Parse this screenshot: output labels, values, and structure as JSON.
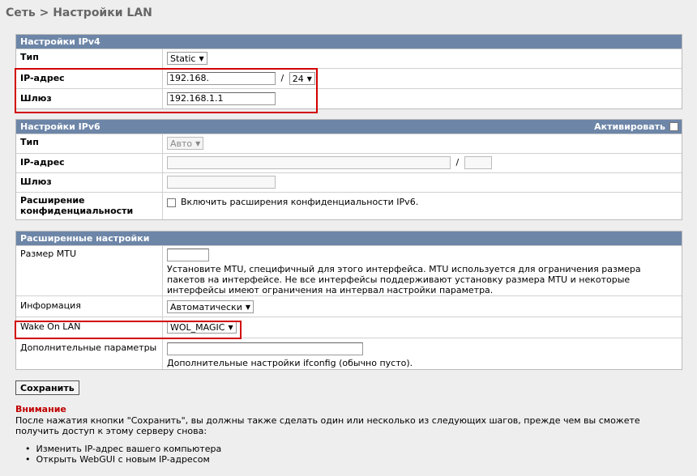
{
  "breadcrumb": "Сеть > Настройки LAN",
  "ipv4": {
    "header": "Настройки IPv4",
    "type_label": "Тип",
    "type_value": "Static",
    "ip_label": "IP-адрес",
    "ip_value": "192.168.",
    "slash": "/",
    "mask_value": "24",
    "gw_label": "Шлюз",
    "gw_value": "192.168.1.1"
  },
  "ipv6": {
    "header": "Настройки IPv6",
    "activate_label": "Активировать",
    "type_label": "Тип",
    "type_value": "Авто",
    "ip_label": "IP-адрес",
    "slash": "/",
    "gw_label": "Шлюз",
    "privacy_label": "Расширение конфиденциальности",
    "privacy_option": "Включить расширения конфиденциальности IPv6."
  },
  "advanced": {
    "header": "Расширенные настройки",
    "mtu_label": "Размер MTU",
    "mtu_help": "Установите MTU, специфичный для этого интерфейса. MTU используется для ограничения размера пакетов на интерфейсе. Не все интерфейсы поддерживают установку размера MTU и некоторые интерфейсы имеют ограничения на интервал настройки параметра.",
    "info_label": "Информация",
    "info_value": "Автоматически",
    "wol_label": "Wake On LAN",
    "wol_value": "WOL_MAGIC",
    "extra_label": "Дополнительные параметры",
    "extra_help": "Дополнительные настройки ifconfig (обычно пусто)."
  },
  "save_label": "Сохранить",
  "warning": {
    "title": "Внимание",
    "text": "После нажатия кнопки \"Сохранить\", вы должны также сделать один или несколько из следующих шагов, прежде чем вы сможете получить доступ к этому серверу снова:",
    "steps": [
      "Изменить IP-адрес вашего компьютера",
      "Открыть WebGUI с новым IP-адресом"
    ]
  }
}
